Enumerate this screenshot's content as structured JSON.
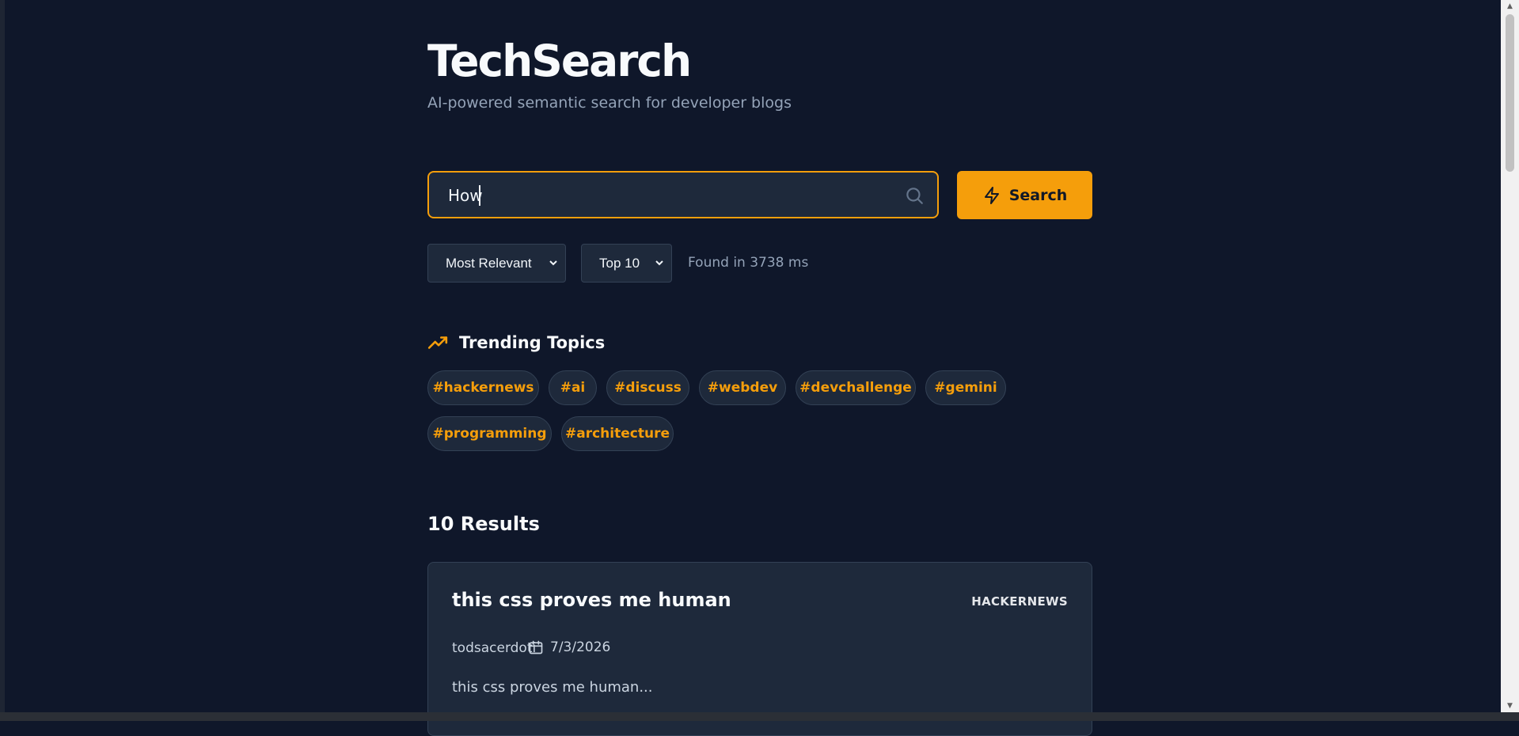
{
  "header": {
    "title": "TechSearch",
    "subtitle": "AI-powered semantic search for developer blogs"
  },
  "search": {
    "value": "How",
    "placeholder": "",
    "button_label": "Search",
    "search_icon": "search-icon",
    "button_icon": "bolt-icon"
  },
  "filters": {
    "sort_selected": "Most Relevant",
    "limit_selected": "Top 10",
    "found_text": "Found in 3738 ms"
  },
  "trending": {
    "title": "Trending Topics",
    "icon": "trending-up-icon",
    "tags": [
      "#hackernews",
      "#ai",
      "#discuss",
      "#webdev",
      "#devchallenge",
      "#gemini",
      "#programming",
      "#architecture"
    ]
  },
  "results": {
    "heading": "10 Results",
    "items": [
      {
        "title": "this css proves me human",
        "source": "HACKERNEWS",
        "author": "todsacerdoti",
        "date": "7/3/2026",
        "snippet": "this css proves me human..."
      }
    ]
  },
  "colors": {
    "background": "#0f172a",
    "surface": "#1e293b",
    "accent": "#f59e0b",
    "text": "#f8fafc",
    "muted": "#94a3b8"
  }
}
